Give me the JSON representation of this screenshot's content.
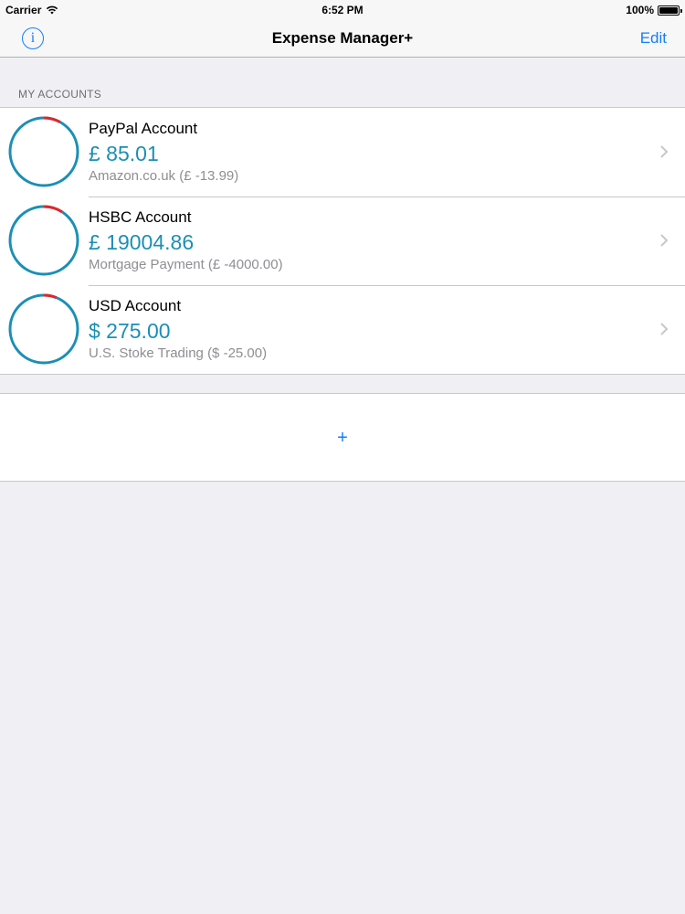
{
  "status_bar": {
    "carrier": "Carrier",
    "time": "6:52 PM",
    "battery": "100%",
    "battery_level": 1.0
  },
  "nav": {
    "title": "Expense Manager+",
    "edit_label": "Edit",
    "info_label": "i"
  },
  "section": {
    "header": "MY ACCOUNTS"
  },
  "accounts": [
    {
      "name": "PayPal Account",
      "balance": "£ 85.01",
      "last_transaction": "Amazon.co.uk (£ -13.99)",
      "spent_fraction": 0.08
    },
    {
      "name": "HSBC Account",
      "balance": "£ 19004.86",
      "last_transaction": "Mortgage Payment (£ -4000.00)",
      "spent_fraction": 0.09
    },
    {
      "name": "USD Account",
      "balance": "$ 275.00",
      "last_transaction": "U.S. Stoke Trading ($ -25.00)",
      "spent_fraction": 0.06
    }
  ],
  "add_panel": {
    "add_label": "+"
  },
  "colors": {
    "accent": "#147efb",
    "balance": "#1b8fb5",
    "ring_main": "#1b8fb5",
    "ring_spent": "#e0262b"
  },
  "icons": {
    "wifi": "wifi-icon",
    "info": "info-icon",
    "chevron": "chevron-right-icon"
  }
}
